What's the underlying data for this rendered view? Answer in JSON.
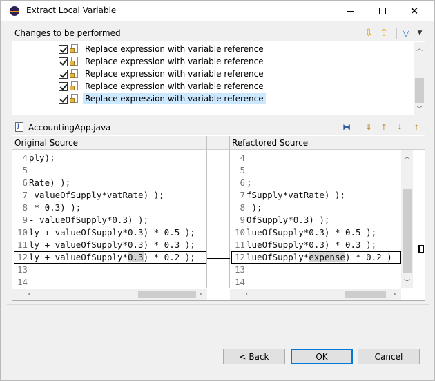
{
  "window": {
    "title": "Extract Local Variable"
  },
  "changes": {
    "header": "Changes to be performed",
    "items": [
      {
        "label": "Replace expression with variable reference",
        "checked": true,
        "selected": false
      },
      {
        "label": "Replace expression with variable reference",
        "checked": true,
        "selected": false
      },
      {
        "label": "Replace expression with variable reference",
        "checked": true,
        "selected": false
      },
      {
        "label": "Replace expression with variable reference",
        "checked": true,
        "selected": false
      },
      {
        "label": "Replace expression with variable reference",
        "checked": true,
        "selected": true
      }
    ]
  },
  "compare": {
    "file_name": "AccountingApp.java",
    "left_header": "Original Source",
    "right_header": "Refactored Source",
    "left_lines": [
      {
        "num": "4",
        "code": "ply);"
      },
      {
        "num": "5",
        "code": ""
      },
      {
        "num": "6",
        "code": "Rate) );"
      },
      {
        "num": "7",
        "code": " valueOfSupply*vatRate) );"
      },
      {
        "num": "8",
        "code": " * 0.3) );"
      },
      {
        "num": "9",
        "code": "- valueOfSupply*0.3) );"
      },
      {
        "num": "10",
        "code": "ly + valueOfSupply*0.3) * 0.5 );"
      },
      {
        "num": "11",
        "code": "ly + valueOfSupply*0.3) * 0.3 );"
      },
      {
        "num": "12",
        "code_before": "ly + valueOfSupply*",
        "code_hl": "0.3",
        "code_after": ") * 0.2 );"
      },
      {
        "num": "13",
        "code": ""
      },
      {
        "num": "14",
        "code": ""
      }
    ],
    "right_lines": [
      {
        "num": "4",
        "code": ""
      },
      {
        "num": "5",
        "code": ""
      },
      {
        "num": "6",
        "code": ";"
      },
      {
        "num": "7",
        "code": "fSupply*vatRate) );"
      },
      {
        "num": "8",
        "code": " );"
      },
      {
        "num": "9",
        "code": "OfSupply*0.3) );"
      },
      {
        "num": "10",
        "code": "lueOfSupply*0.3) * 0.5 );"
      },
      {
        "num": "11",
        "code": "lueOfSupply*0.3) * 0.3 );"
      },
      {
        "num": "12",
        "code_before": "lueOfSupply*",
        "code_hl": "expense",
        "code_after": ") * 0.2 )"
      },
      {
        "num": "13",
        "code": ""
      },
      {
        "num": "14",
        "code": ""
      }
    ]
  },
  "buttons": {
    "back": "< Back",
    "ok": "OK",
    "cancel": "Cancel"
  }
}
